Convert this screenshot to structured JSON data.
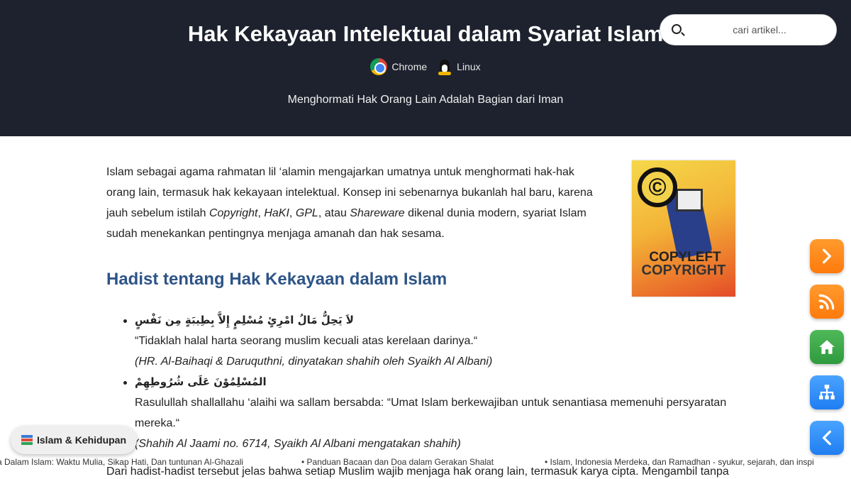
{
  "header": {
    "title": "Hak Kekayaan Intelektual dalam Syariat Islam",
    "badges": [
      {
        "label": "Chrome",
        "icon": "chrome-icon"
      },
      {
        "label": "Linux",
        "icon": "tux-icon"
      }
    ],
    "subtitle": "Menghormati Hak Orang Lain Adalah Bagian dari Iman"
  },
  "search": {
    "placeholder": "cari artikel..."
  },
  "article": {
    "intro_a": "Islam sebagai agama rahmatan lil ‘alamin mengajarkan umatnya untuk menghormati hak-hak orang lain, termasuk hak kekayaan intelektual. Konsep ini sebenarnya bukanlah hal baru, karena jauh sebelum istilah ",
    "term1": "Copyright",
    "sep1": ", ",
    "term2": "HaKI",
    "sep2": ", ",
    "term3": "GPL",
    "sep3": ", atau ",
    "term4": "Shareware",
    "intro_b": " dikenal dunia modern, syariat Islam sudah menekankan pentingnya menjaga amanah dan hak sesama.",
    "image_text": {
      "cc": "©",
      "line1": "COPYLEFT",
      "line2": "COPYRIGHT"
    },
    "section_heading": "Hadist tentang Hak Kekayaan dalam Islam",
    "hadist": [
      {
        "arabic": "لاَ يَحِلُّ مَالُ امْرِئٍ مُسْلِمٍ إِلاَّ بِطِيبَةٍ مِن نَفْسٍ",
        "translation": "“Tidaklah halal harta seorang muslim kecuali atas kerelaan darinya.“",
        "source": "(HR. Al-Baihaqi & Daruquthni, dinyatakan shahih oleh Syaikh Al Albani)"
      },
      {
        "arabic": "المُسْلِمُوْنَ عَلَى شُرُوطِهِمْ",
        "translation": "Rasulullah shallallahu ‘alaihi wa sallam bersabda: “Umat Islam berkewajiban untuk senantiasa memenuhi persyaratan mereka.“",
        "source": "(Shahih Al Jaami no. 6714, Syaikh Al Albani mengatakan shahih)"
      }
    ],
    "closing": "Dari hadist-hadist tersebut jelas bahwa setiap Muslim wajib menjaga hak orang lain, termasuk karya cipta. Mengambil tanpa"
  },
  "ticker": {
    "items": [
      "a Dalam Islam: Waktu Mulia, Sikap Hati, Dan tuntunan Al-Ghazali",
      "• Panduan Bacaan dan Doa dalam Gerakan Shalat",
      "• Islam, Indonesia Merdeka, dan Ramadhan - syukur, sejarah, dan inspi"
    ]
  },
  "category_chip": {
    "label": "Islam & Kehidupan",
    "icon": "books-icon"
  },
  "side_buttons": [
    {
      "name": "next",
      "icon": "chevron-right-icon",
      "color": "#ff8a1c"
    },
    {
      "name": "rss",
      "icon": "rss-icon",
      "color": "#ff8a1c"
    },
    {
      "name": "home",
      "icon": "home-icon",
      "color": "#3aa84a"
    },
    {
      "name": "sitemap",
      "icon": "sitemap-icon",
      "color": "#2f8ef7"
    },
    {
      "name": "prev",
      "icon": "chevron-left-icon",
      "color": "#2f8ef7"
    }
  ]
}
